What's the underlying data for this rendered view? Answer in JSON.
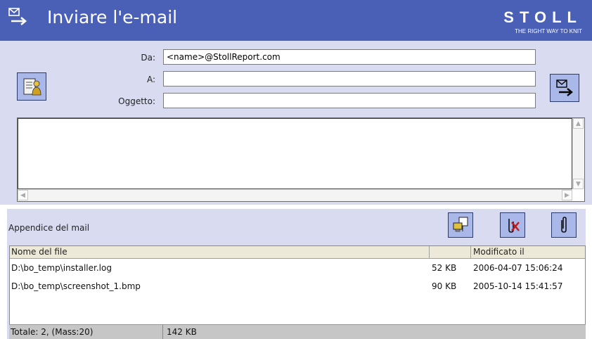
{
  "header": {
    "title": "Inviare l'e-mail",
    "brand_name": "STOLL",
    "brand_tagline": "THE RIGHT WAY TO KNIT",
    "title_icon": "mail-send-icon",
    "bg_color": "#4a5fb6"
  },
  "form": {
    "from_label": "Da:",
    "from_value": "<name>@StollReport.com",
    "to_label": "A:",
    "to_value": "",
    "subject_label": "Oggetto:",
    "subject_value": "",
    "body_value": "",
    "address_book_icon": "address-book-icon",
    "send_icon": "send-mail-icon"
  },
  "attachments": {
    "title": "Appendice del mail",
    "columns": {
      "name": "Nome del file",
      "size": "",
      "modified": "Modificato il"
    },
    "files": [
      {
        "name": "D:\\bo_temp\\installer.log",
        "size": "52 KB",
        "modified": "2006-04-07 15:06:24"
      },
      {
        "name": "D:\\bo_temp\\screenshot_1.bmp",
        "size": "90 KB",
        "modified": "2005-10-14 15:41:57"
      }
    ],
    "buttons": {
      "add_icon": "add-attachment-icon",
      "remove_icon": "remove-attachment-icon",
      "clip_icon": "paperclip-icon"
    }
  },
  "status": {
    "count_text": "Totale: 2, (Mass:20)",
    "size_text": "142 KB"
  }
}
